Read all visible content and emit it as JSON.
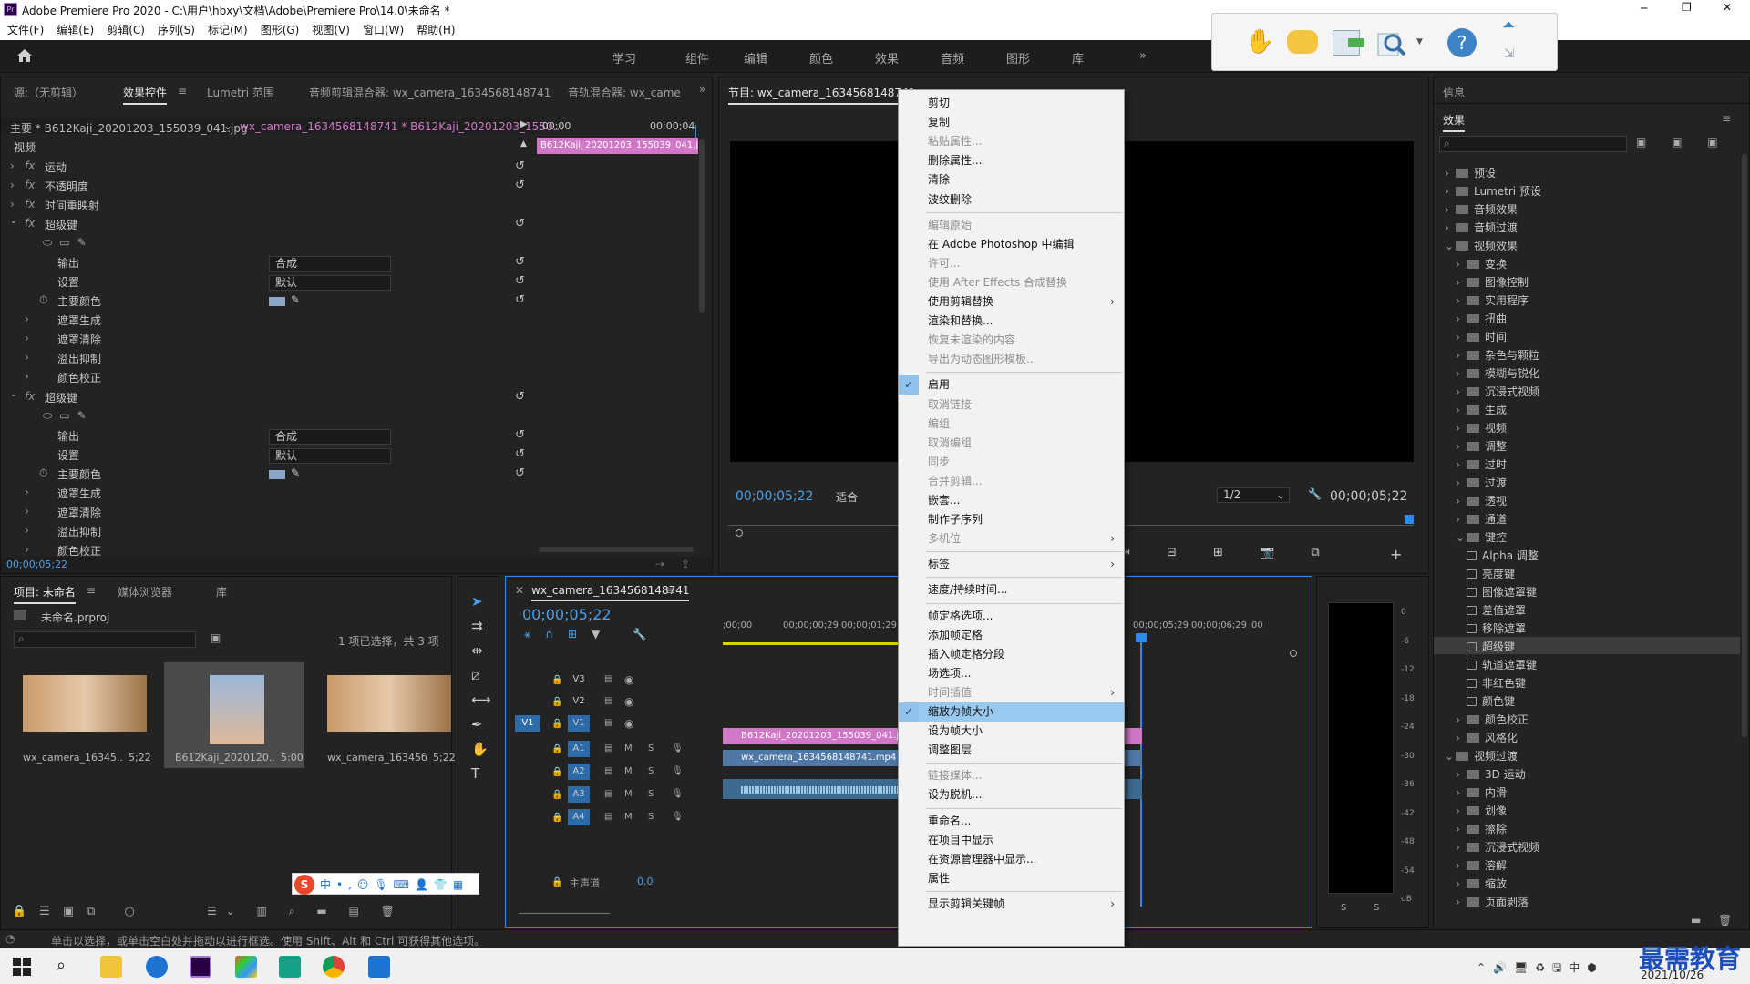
{
  "app": {
    "title": "Adobe Premiere Pro 2020 - C:\\用户\\hbxy\\文档\\Adobe\\Premiere Pro\\14.0\\未命名 *"
  },
  "menu": [
    "文件(F)",
    "编辑(E)",
    "剪辑(C)",
    "序列(S)",
    "标记(M)",
    "图形(G)",
    "视图(V)",
    "窗口(W)",
    "帮助(H)"
  ],
  "workspaces": [
    "学习",
    "组件",
    "编辑",
    "颜色",
    "效果",
    "音频",
    "图形",
    "库"
  ],
  "source_tabs": {
    "source": "源:（无剪辑）",
    "effect_controls": "效果控件",
    "lumetri": "Lumetri 范围",
    "audio_clip_mixer": "音频剪辑混合器: wx_camera_1634568148741",
    "audio_track_mixer": "音轨混合器: wx_came"
  },
  "effect_controls": {
    "master": "主要 * B612Kaji_20201203_155039_041.jpg",
    "clip": "wx_camera_1634568148741 * B612Kaji_20201203_1550...",
    "tc_start": ";00;00",
    "tc_end": "00;00;04",
    "mini_clip": "B612Kaji_20201203_155039_041.jp",
    "video": "视频",
    "motion": "运动",
    "opacity": "不透明度",
    "time_remap": "时间重映射",
    "ultra_key": "超级键",
    "output_label": "输出",
    "output_value": "合成",
    "settings_label": "设置",
    "settings_value": "默认",
    "key_color": "主要颜色",
    "matte_gen": "遮罩生成",
    "matte_cleanup": "遮罩清除",
    "spill": "溢出抑制",
    "color_correction": "颜色校正",
    "timecode": "00;00;05;22"
  },
  "program": {
    "tab": "节目: wx_camera_1634568148741",
    "tc": "00;00;05;22",
    "fit": "适合",
    "quality": "1/2",
    "duration": "00;00;05;22"
  },
  "project": {
    "tabs": [
      "项目: 未命名",
      "媒体浏览器",
      "库"
    ],
    "file": "未命名.prproj",
    "count": "1 项已选择，共 3 项",
    "items": [
      {
        "name": "wx_camera_16345...",
        "dur": "5;22"
      },
      {
        "name": "B612Kaji_2020120...",
        "dur": "5:00"
      },
      {
        "name": "wx_camera_16345б...",
        "dur": "5;22"
      }
    ]
  },
  "timeline": {
    "tab": "wx_camera_1634568148741",
    "tc": "00;00;05;22",
    "ruler": [
      ";00;00",
      "00;00;00;29",
      "00;00;01;29",
      "00;00;05;29",
      "00;00;06;29",
      "00"
    ],
    "tracks_v": [
      "V3",
      "V2",
      "V1"
    ],
    "tracks_a": [
      "A1",
      "A2",
      "A3",
      "A4"
    ],
    "master": "主声道",
    "master_val": "0.0",
    "clip_v2": "B612Kaji_20201203_155039_041.jpg",
    "clip_v1": "wx_camera_1634568148741.mp4 [V]",
    "src_v1": "V1"
  },
  "meter": {
    "ticks": [
      "0",
      "-6",
      "-12",
      "-18",
      "-24",
      "-30",
      "-36",
      "-42",
      "-48",
      "-54",
      "dB"
    ],
    "solo": [
      "S",
      "S"
    ]
  },
  "effects_panel": {
    "info": "信息",
    "title": "效果",
    "items": [
      {
        "t": "预设",
        "l": 0
      },
      {
        "t": "Lumetri 预设",
        "l": 0
      },
      {
        "t": "音频效果",
        "l": 0
      },
      {
        "t": "音频过渡",
        "l": 0
      },
      {
        "t": "视频效果",
        "l": 0,
        "open": true
      },
      {
        "t": "变换",
        "l": 1
      },
      {
        "t": "图像控制",
        "l": 1
      },
      {
        "t": "实用程序",
        "l": 1
      },
      {
        "t": "扭曲",
        "l": 1
      },
      {
        "t": "时间",
        "l": 1
      },
      {
        "t": "杂色与颗粒",
        "l": 1
      },
      {
        "t": "模糊与锐化",
        "l": 1
      },
      {
        "t": "沉浸式视频",
        "l": 1
      },
      {
        "t": "生成",
        "l": 1
      },
      {
        "t": "视频",
        "l": 1
      },
      {
        "t": "调整",
        "l": 1
      },
      {
        "t": "过时",
        "l": 1
      },
      {
        "t": "过渡",
        "l": 1
      },
      {
        "t": "透视",
        "l": 1
      },
      {
        "t": "通道",
        "l": 1
      },
      {
        "t": "键控",
        "l": 1,
        "open": true
      },
      {
        "t": "Alpha 调整",
        "l": 2
      },
      {
        "t": "亮度键",
        "l": 2
      },
      {
        "t": "图像遮罩键",
        "l": 2
      },
      {
        "t": "差值遮罩",
        "l": 2
      },
      {
        "t": "移除遮罩",
        "l": 2
      },
      {
        "t": "超级键",
        "l": 2,
        "sel": true
      },
      {
        "t": "轨道遮罩键",
        "l": 2
      },
      {
        "t": "非红色键",
        "l": 2
      },
      {
        "t": "颜色键",
        "l": 2
      },
      {
        "t": "颜色校正",
        "l": 1
      },
      {
        "t": "风格化",
        "l": 1
      },
      {
        "t": "视频过渡",
        "l": 0,
        "open": true
      },
      {
        "t": "3D 运动",
        "l": 1
      },
      {
        "t": "内滑",
        "l": 1
      },
      {
        "t": "划像",
        "l": 1
      },
      {
        "t": "擦除",
        "l": 1
      },
      {
        "t": "沉浸式视频",
        "l": 1
      },
      {
        "t": "溶解",
        "l": 1
      },
      {
        "t": "缩放",
        "l": 1
      },
      {
        "t": "页面剥落",
        "l": 1
      }
    ]
  },
  "context_menu": [
    {
      "t": "剪切"
    },
    {
      "t": "复制"
    },
    {
      "t": "粘贴属性...",
      "dis": true
    },
    {
      "t": "删除属性..."
    },
    {
      "t": "清除"
    },
    {
      "t": "波纹删除"
    },
    {
      "sep": true
    },
    {
      "t": "编辑原始",
      "dis": true
    },
    {
      "t": "在 Adobe Photoshop 中编辑"
    },
    {
      "t": "许可...",
      "dis": true
    },
    {
      "t": "使用 After Effects 合成替换",
      "dis": true
    },
    {
      "t": "使用剪辑替换",
      "sub": true
    },
    {
      "t": "渲染和替换..."
    },
    {
      "t": "恢复未渲染的内容",
      "dis": true
    },
    {
      "t": "导出为动态图形模板...",
      "dis": true
    },
    {
      "sep": true
    },
    {
      "t": "启用",
      "chk": true
    },
    {
      "t": "取消链接",
      "dis": true
    },
    {
      "t": "编组",
      "dis": true
    },
    {
      "t": "取消编组",
      "dis": true
    },
    {
      "t": "同步",
      "dis": true
    },
    {
      "t": "合并剪辑...",
      "dis": true
    },
    {
      "t": "嵌套..."
    },
    {
      "t": "制作子序列"
    },
    {
      "t": "多机位",
      "dis": true,
      "sub": true
    },
    {
      "sep": true
    },
    {
      "t": "标签",
      "sub": true
    },
    {
      "sep": true
    },
    {
      "t": "速度/持续时间..."
    },
    {
      "sep": true
    },
    {
      "t": "帧定格选项..."
    },
    {
      "t": "添加帧定格"
    },
    {
      "t": "插入帧定格分段"
    },
    {
      "t": "场选项..."
    },
    {
      "t": "时间插值",
      "dis": true,
      "sub": true
    },
    {
      "t": "缩放为帧大小",
      "chk": true,
      "hl": true
    },
    {
      "t": "设为帧大小"
    },
    {
      "t": "调整图层"
    },
    {
      "sep": true
    },
    {
      "t": "链接媒体...",
      "dis": true
    },
    {
      "t": "设为脱机..."
    },
    {
      "sep": true
    },
    {
      "t": "重命名..."
    },
    {
      "t": "在项目中显示"
    },
    {
      "t": "在资源管理器中显示..."
    },
    {
      "t": "属性"
    },
    {
      "sep": true
    },
    {
      "t": "显示剪辑关键帧",
      "sub": true
    }
  ],
  "status": "单击以选择，或单击空白处并拖动以进行框选。使用 Shift、Alt 和 Ctrl 可获得其他选项。",
  "taskbar": {
    "date": "2021/10/26",
    "ime": "中",
    "watermark": "最需教育"
  },
  "colors": {
    "accent": "#2d8ceb",
    "clip_pink": "#d277c8",
    "clip_blue": "#4f78a7",
    "audio": "#3c6b8f"
  }
}
